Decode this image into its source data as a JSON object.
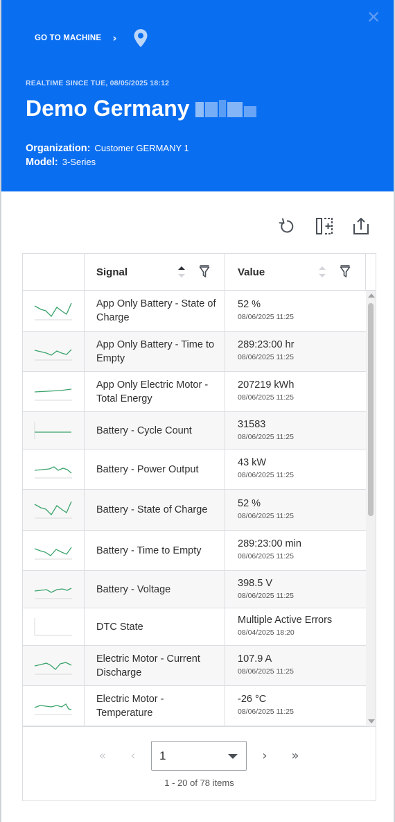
{
  "header": {
    "go_to_machine": "GO TO MACHINE",
    "realtime": "REALTIME SINCE TUE, 08/05/2025 18:12",
    "title": "Demo Germany",
    "organization_label": "Organization:",
    "organization_value": "Customer GERMANY 1",
    "model_label": "Model:",
    "model_value": "3-Series"
  },
  "colors": {
    "header_bg": "#0a6ef0",
    "spark": "#3aa36b"
  },
  "toolbar": {
    "icons": [
      "refresh-icon",
      "columns-icon",
      "export-icon"
    ]
  },
  "grid": {
    "columns": {
      "signal": "Signal",
      "value": "Value"
    },
    "rows": [
      {
        "signal": "App Only Battery - State of Charge",
        "value": "52 %",
        "time": "08/06/2025 11:25"
      },
      {
        "signal": "App Only Battery - Time to Empty",
        "value": "289:23:00 hr",
        "time": "08/06/2025 11:25"
      },
      {
        "signal": "App Only Electric Motor - Total Energy",
        "value": "207219 kWh",
        "time": "08/06/2025 11:25"
      },
      {
        "signal": "Battery - Cycle Count",
        "value": "31583",
        "time": "08/06/2025 11:25"
      },
      {
        "signal": "Battery - Power Output",
        "value": "43 kW",
        "time": "08/06/2025 11:25"
      },
      {
        "signal": "Battery - State of Charge",
        "value": "52 %",
        "time": "08/06/2025 11:25"
      },
      {
        "signal": "Battery - Time to Empty",
        "value": "289:23:00 min",
        "time": "08/06/2025 11:25"
      },
      {
        "signal": "Battery - Voltage",
        "value": "398.5 V",
        "time": "08/06/2025 11:25"
      },
      {
        "signal": "DTC State",
        "value": "Multiple Active Errors",
        "time": "08/04/2025 18:20"
      },
      {
        "signal": "Electric Motor - Current Discharge",
        "value": "107.9 A",
        "time": "08/06/2025 11:25"
      },
      {
        "signal": "Electric Motor - Temperature",
        "value": "-26 °C",
        "time": "08/06/2025 11:25"
      },
      {
        "signal": "",
        "value": "",
        "time": ""
      }
    ]
  },
  "pager": {
    "page": "1",
    "info": "1 - 20 of 78 items"
  }
}
